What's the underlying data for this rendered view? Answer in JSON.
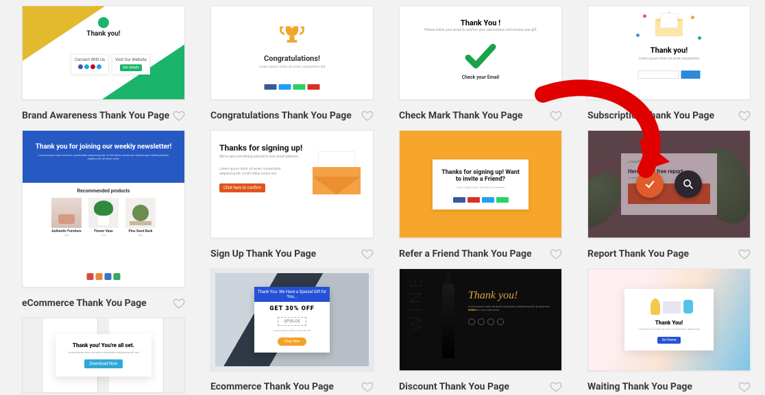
{
  "templates": [
    {
      "id": "brand",
      "title": "Brand Awareness Thank You Page",
      "thumb": {
        "heading": "Thank you!",
        "box1": "Connect With Us",
        "box2": "Visit Our Website",
        "btn": "Get details"
      }
    },
    {
      "id": "congrats",
      "title": "Congratulations Thank You Page",
      "thumb": {
        "heading": "Congratulations!"
      }
    },
    {
      "id": "check",
      "title": "Check Mark Thank You Page",
      "thumb": {
        "heading": "Thank You !",
        "sub": "Check your Email"
      }
    },
    {
      "id": "sub",
      "title": "Subscription Thank You Page",
      "thumb": {
        "heading": "Thank you!"
      }
    },
    {
      "id": "ecom",
      "title": "eCommerce Thank You Page",
      "thumb": {
        "heading": "Thank you for joining our weekly newsletter!",
        "rec": "Recommended products",
        "p1": "Authentic Furniture",
        "p2": "Flower Vase",
        "p3": "Pine Seed Rack"
      }
    },
    {
      "id": "signup",
      "title": "Sign Up Thank You Page",
      "thumb": {
        "heading": "Thanks for signing up!",
        "btn": "Click here to confirm"
      }
    },
    {
      "id": "refer",
      "title": "Refer a Friend Thank You Page",
      "thumb": {
        "heading": "Thanks for signing up! Want to invite a Friend?"
      }
    },
    {
      "id": "report",
      "title": "Report Thank You Page",
      "thumb": {
        "heading": "Here's your free report"
      }
    },
    {
      "id": "set",
      "title": "",
      "thumb": {
        "heading": "Thank you! You're all set.",
        "btn": "Download Now"
      }
    },
    {
      "id": "ecom2",
      "title": "Ecommerce Thank You Page",
      "thumb": {
        "bar": "Thank You. We Have a Special Gift for You...",
        "big": "GET 30% OFF",
        "code": "SP30-OS",
        "btn": "Shop Now"
      }
    },
    {
      "id": "disc",
      "title": "Discount Thank You Page",
      "thumb": {
        "heading": "Thank you!",
        "wine": "WINE"
      }
    },
    {
      "id": "wait",
      "title": "Waiting Thank You Page",
      "thumb": {
        "heading": "Thank You!",
        "btn": "Go Home"
      }
    }
  ],
  "hover_actions": {
    "select": "select-template",
    "preview": "preview-template"
  },
  "colors": {
    "badge_blue": "#3b5998",
    "badge_cyan": "#1da1f2",
    "badge_green": "#25d366",
    "badge_red": "#d93025",
    "soc_fb": "#3b5998",
    "soc_tw": "#1da1f2",
    "soc_pin": "#bd081c",
    "soc_ig": "#c13584",
    "sq_red": "#d84b3f",
    "sq_orange": "#e8893a",
    "sq_blue": "#3a74c4",
    "sq_green": "#39a85b"
  }
}
